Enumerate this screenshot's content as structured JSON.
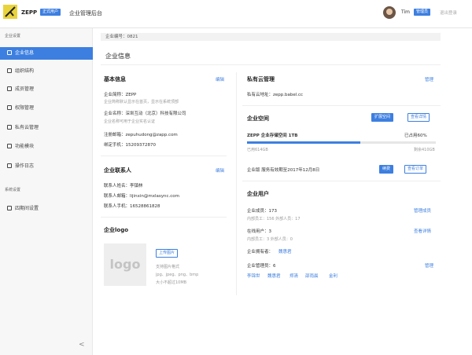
{
  "header": {
    "brand": "ZEPP",
    "badge": "正式用户",
    "title": "企业管理后台",
    "user_name": "Tim",
    "admin_badge": "管理员",
    "logout": "退出登录"
  },
  "sidebar": {
    "group1": "企业设置",
    "items": [
      {
        "label": "企业信息"
      },
      {
        "label": "组织结构"
      },
      {
        "label": "成员管理"
      },
      {
        "label": "权限管理"
      },
      {
        "label": "私有云管理"
      },
      {
        "label": "功能模块"
      },
      {
        "label": "操作日志"
      }
    ],
    "group2": "系统设置",
    "items2": [
      {
        "label": "四期间设置"
      }
    ],
    "collapse": "<"
  },
  "main": {
    "corp_id": "企业编号：0821",
    "title": "企业信息",
    "basic": {
      "title": "基本信息",
      "edit": "编辑",
      "short_name": "企业简称：ZEPP",
      "short_hint": "企业简称默认显示在首页，显示在系统顶部",
      "full_name": "企业名称：深圳互动（北京）科技有限公司",
      "full_hint": "企业名称可用于企业实名认证",
      "email": "注册邮箱：zepuhudong@zapp.com",
      "phone": "绑定手机：15209372870"
    },
    "contact": {
      "title": "企业联系人",
      "edit": "编辑",
      "name": "联系人姓名：李镇林",
      "email": "联系人邮箱：lijinxin@mxlasync.com",
      "phone": "联系人手机：16528861828"
    },
    "logo": {
      "title": "企业logo",
      "placeholder": "logo",
      "upload": "上传图片",
      "hint1": "支持图片格式",
      "hint2": "jpg、jpeg、png、bmp",
      "hint3": "大小不超过10MB"
    },
    "private_cloud": {
      "title": "私有云管理",
      "manage": "管理",
      "address": "私有云地址：zepp.babel.cc"
    },
    "space": {
      "title": "企业空间",
      "expand": "扩展空间",
      "detail": "查看详情",
      "storage": "ZEPP 企业存储空间 1TB",
      "used_pct_label": "已占用60%",
      "used": "已用614GB",
      "left": "剩余410GB",
      "progress": 0.6,
      "service": "企业版  服务有效期至2017年12月8日",
      "renew": "续费",
      "orders": "查看订单"
    },
    "users": {
      "title": "企业用户",
      "members": "企业成员：173",
      "members_detail": "内部员工：156  外部人员：17",
      "members_link": "管理成员",
      "online": "在线用户：3",
      "online_detail": "内部员工：3  外部人员：0",
      "online_link": "查看详情",
      "owner_label": "企业拥有者：",
      "owner_name": "魏惠君",
      "admins": "企业管理员：6",
      "admins_link": "管理",
      "admin_names": [
        "李锦世",
        "魏惠君",
        "郑清",
        "邵雨晨",
        "金利"
      ]
    }
  },
  "colors": {
    "accent": "#3d7fe0",
    "sidebar_bg": "#f7f7f7"
  }
}
